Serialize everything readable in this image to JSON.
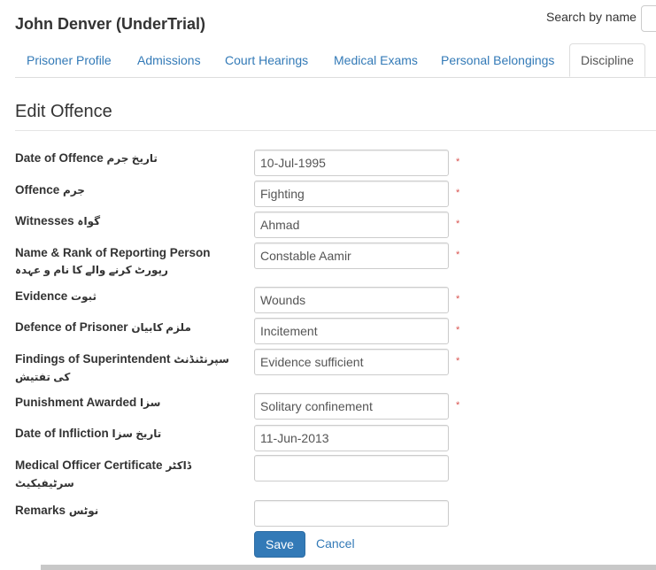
{
  "header": {
    "title": "John Denver (UnderTrial)",
    "search_label": "Search by name"
  },
  "tabs": [
    {
      "label": "Prisoner Profile"
    },
    {
      "label": "Admissions"
    },
    {
      "label": "Court Hearings"
    },
    {
      "label": "Medical Exams"
    },
    {
      "label": "Personal Belongings"
    },
    {
      "label": "Discipline",
      "active": true
    }
  ],
  "form": {
    "title": "Edit Offence",
    "required_mark": "*",
    "fields": [
      {
        "label": "Date of Offence",
        "urdu": "تاریخ جرم",
        "value": "10-Jul-1995",
        "required": true
      },
      {
        "label": "Offence",
        "urdu": "جرم",
        "value": "Fighting",
        "required": true
      },
      {
        "label": "Witnesses",
        "urdu": "گواہ",
        "value": "Ahmad",
        "required": true
      },
      {
        "label": "Name & Rank of Reporting Person",
        "urdu": "رپورٹ کرنے والے کا نام و عہدہ",
        "value": "Constable Aamir",
        "required": true
      },
      {
        "label": "Evidence",
        "urdu": "ثبوت",
        "value": "Wounds",
        "required": true
      },
      {
        "label": "Defence of Prisoner",
        "urdu": "ملزم کابیان",
        "value": "Incitement",
        "required": true
      },
      {
        "label": "Findings of Superintendent",
        "urdu": "سپرنٹنڈنٹ کی تفتیش",
        "value": "Evidence sufficient",
        "required": true
      },
      {
        "label": "Punishment Awarded",
        "urdu": "سزا",
        "value": "Solitary confinement",
        "required": true
      },
      {
        "label": "Date of Infliction",
        "urdu": "تاریخ سزا",
        "value": "11-Jun-2013",
        "required": false
      },
      {
        "label": "Medical Officer Certificate",
        "urdu": "ڈاکٹر سرٹیفیکیٹ",
        "value": "",
        "required": false
      },
      {
        "label": "Remarks",
        "urdu": "نوٹس",
        "value": "",
        "required": false
      }
    ],
    "save_label": "Save",
    "cancel_label": "Cancel"
  },
  "colors": {
    "link": "#337ab7",
    "primary_button": "#337ab7",
    "required": "#d9534f"
  }
}
